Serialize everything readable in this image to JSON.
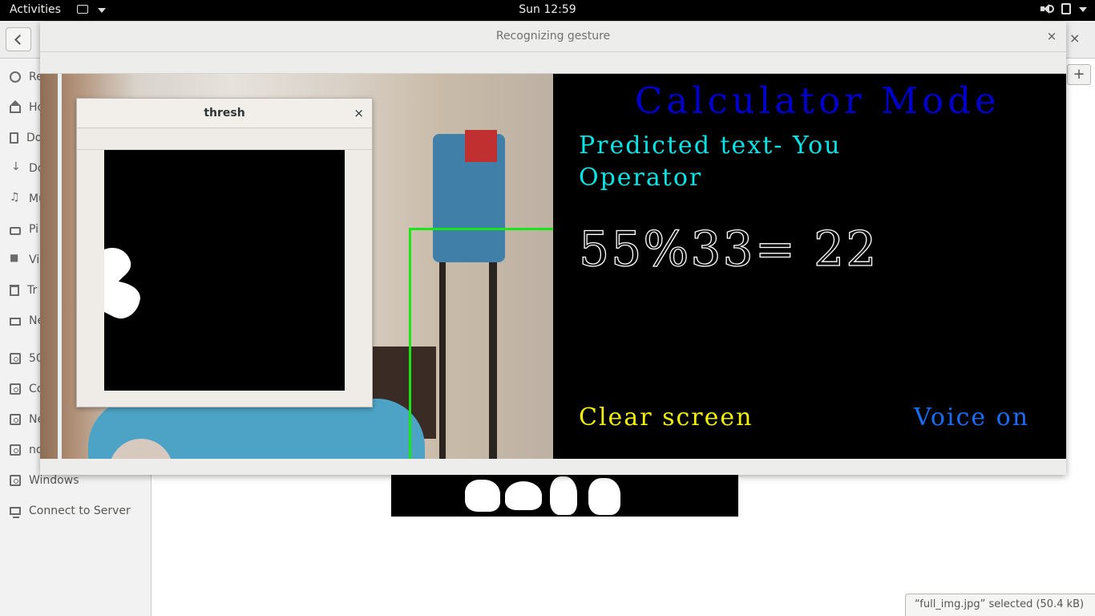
{
  "topbar": {
    "activities": "Activities",
    "clock": "Sun 12:59",
    "icons": [
      "app-menu-icon",
      "volume-icon",
      "power-icon",
      "system-menu-caret-icon"
    ]
  },
  "files": {
    "sidebar": [
      {
        "label": "Re",
        "icon": "recent-icon"
      },
      {
        "label": "Ho",
        "icon": "home-icon"
      },
      {
        "label": "Do",
        "icon": "documents-icon"
      },
      {
        "label": "Do",
        "icon": "downloads-icon"
      },
      {
        "label": "Mu",
        "icon": "music-icon"
      },
      {
        "label": "Pi",
        "icon": "pictures-icon"
      },
      {
        "label": "Vi",
        "icon": "videos-icon"
      },
      {
        "label": "Tr",
        "icon": "trash-icon"
      },
      {
        "label": "Ne",
        "icon": "network-icon"
      },
      {
        "label": "50",
        "icon": "drive-icon"
      },
      {
        "label": "Co",
        "icon": "drive-icon"
      },
      {
        "label": "Ne",
        "icon": "drive-icon"
      },
      {
        "label": "no",
        "icon": "drive-icon"
      },
      {
        "label": "Windows",
        "icon": "drive-icon"
      },
      {
        "label": "Connect to Server",
        "icon": "server-icon"
      }
    ],
    "close": "×",
    "new_tab": "+",
    "status": "“full_img.jpg” selected  (50.4 kB)"
  },
  "main_window": {
    "title": "Recognizing gesture",
    "close": "×"
  },
  "calculator": {
    "title": "Calculator Mode",
    "predicted": "Predicted text- You",
    "operator": "Operator",
    "expression": "55%33= 22",
    "clear": "Clear screen",
    "voice": "Voice on",
    "colors": {
      "title": "#0000cc",
      "predicted": "#00e5e5",
      "clear": "#f2f200",
      "voice": "#1a6cf5",
      "roi": "#19e619"
    }
  },
  "thresh_window": {
    "title": "thresh",
    "close": "×"
  }
}
